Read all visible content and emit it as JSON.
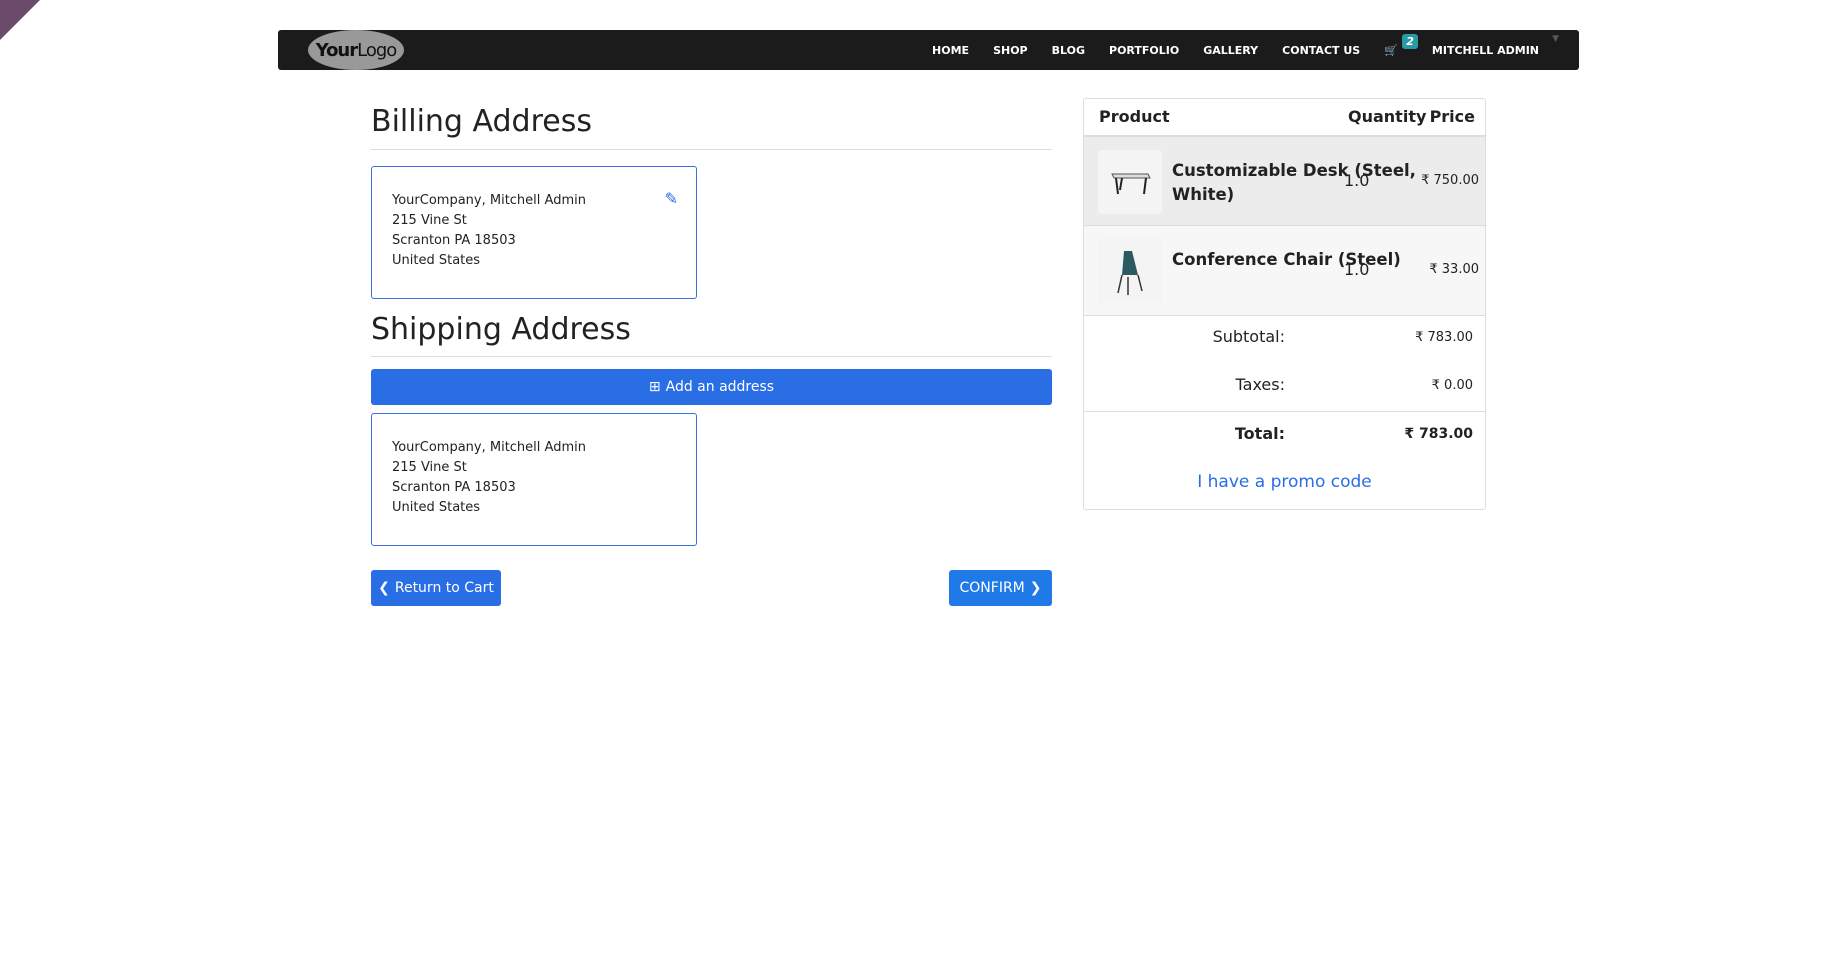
{
  "nav": {
    "logo": "YourLogo",
    "logo_bold": "Your",
    "logo_rest": "Logo",
    "items": [
      "HOME",
      "SHOP",
      "BLOG",
      "PORTFOLIO",
      "GALLERY",
      "CONTACT US"
    ],
    "cart_count": "2",
    "user": "MITCHELL ADMIN"
  },
  "billing": {
    "title": "Billing Address",
    "lines": [
      "YourCompany, Mitchell Admin",
      "215 Vine St",
      "Scranton PA 18503",
      "United States"
    ]
  },
  "shipping": {
    "title": "Shipping Address",
    "add_label": "Add an address",
    "lines": [
      "YourCompany, Mitchell Admin",
      "215 Vine St",
      "Scranton PA 18503",
      "United States"
    ]
  },
  "actions": {
    "return_label": "Return to Cart",
    "confirm_label": "CONFIRM"
  },
  "summary": {
    "headers": [
      "Product",
      "Quantity",
      "Price"
    ],
    "rows": [
      {
        "name": "Customizable Desk (Steel, White)",
        "qty": "1.0",
        "price": "₹ 750.00"
      },
      {
        "name": "Conference Chair (Steel)",
        "qty": "1.0",
        "price": "₹ 33.00"
      }
    ],
    "subtotal_label": "Subtotal:",
    "subtotal": "₹ 783.00",
    "taxes_label": "Taxes:",
    "taxes": "₹ 0.00",
    "total_label": "Total:",
    "total": "₹ 783.00",
    "promo": "I have a promo code"
  }
}
